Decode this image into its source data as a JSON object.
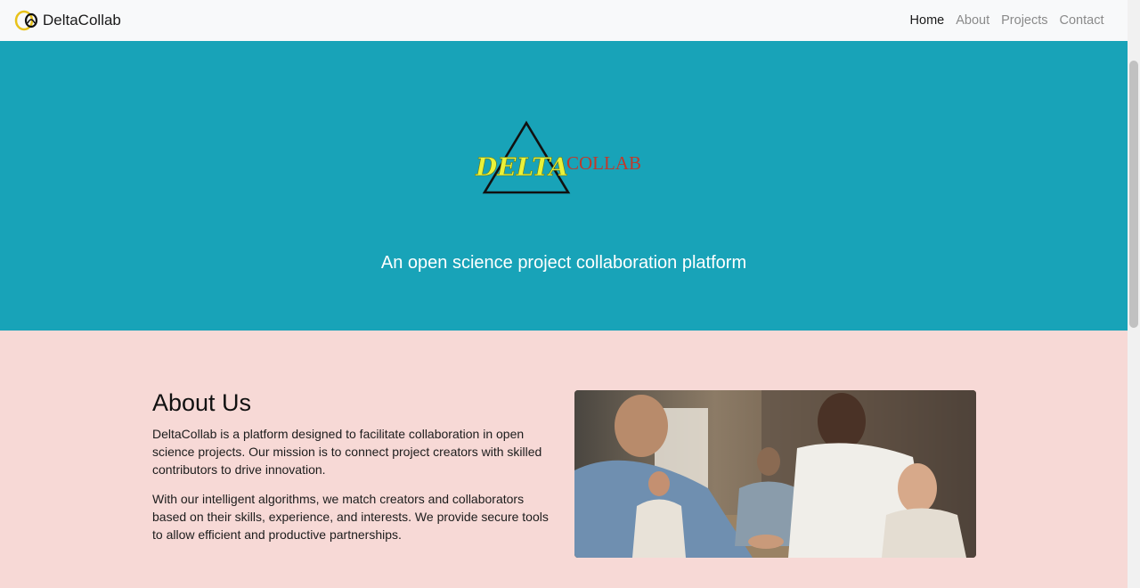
{
  "brand": {
    "name": "DeltaCollab",
    "logo_icon": "double-loop-logo-icon"
  },
  "nav": {
    "items": [
      {
        "label": "Home",
        "active": true
      },
      {
        "label": "About",
        "active": false
      },
      {
        "label": "Projects",
        "active": false
      },
      {
        "label": "Contact",
        "active": false
      }
    ]
  },
  "hero": {
    "logo_text_left": "DELTA",
    "logo_text_right": "COLLAB",
    "tagline": "An open science project collaboration platform",
    "background": "#18a3b8"
  },
  "about": {
    "title": "About Us",
    "paragraph1": "DeltaCollab is a platform designed to facilitate collaboration in open science projects. Our mission is to connect project creators with skilled contributors to drive innovation.",
    "paragraph2": "With our intelligent algorithms, we match creators and collaborators based on their skills, experience, and interests. We provide secure tools to allow efficient and productive partnerships.",
    "background": "#f7d9d6"
  },
  "colors": {
    "accent": "#18a3b8",
    "logo_yellow": "#e9f23a",
    "logo_red": "#c0392b"
  }
}
